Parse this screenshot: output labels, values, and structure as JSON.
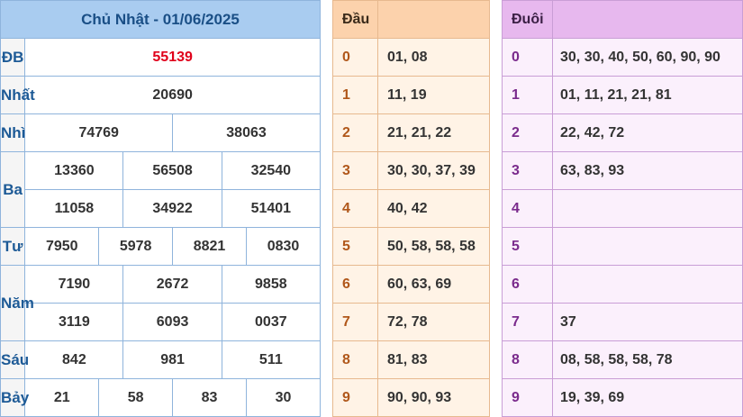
{
  "header": {
    "title": "Chủ Nhật - 01/06/2025"
  },
  "prizes": {
    "db": {
      "label": "ĐB",
      "values": [
        "55139"
      ]
    },
    "nhat": {
      "label": "Nhất",
      "values": [
        "20690"
      ]
    },
    "nhi": {
      "label": "Nhì",
      "values": [
        "74769",
        "38063"
      ]
    },
    "ba": {
      "label": "Ba",
      "values": [
        "13360",
        "56508",
        "32540",
        "11058",
        "34922",
        "51401"
      ]
    },
    "tu": {
      "label": "Tư",
      "values": [
        "7950",
        "5978",
        "8821",
        "0830"
      ]
    },
    "nam": {
      "label": "Năm",
      "values": [
        "7190",
        "2672",
        "9858",
        "3119",
        "6093",
        "0037"
      ]
    },
    "sau": {
      "label": "Sáu",
      "values": [
        "842",
        "981",
        "511"
      ]
    },
    "bay": {
      "label": "Bảy",
      "values": [
        "21",
        "58",
        "83",
        "30"
      ]
    }
  },
  "dau": {
    "header": "Đầu",
    "rows": [
      {
        "key": "0",
        "values": "01, 08"
      },
      {
        "key": "1",
        "values": "11, 19"
      },
      {
        "key": "2",
        "values": "21, 21, 22"
      },
      {
        "key": "3",
        "values": "30, 30, 37, 39"
      },
      {
        "key": "4",
        "values": "40, 42"
      },
      {
        "key": "5",
        "values": "50, 58, 58, 58"
      },
      {
        "key": "6",
        "values": "60, 63, 69"
      },
      {
        "key": "7",
        "values": "72, 78"
      },
      {
        "key": "8",
        "values": "81, 83"
      },
      {
        "key": "9",
        "values": "90, 90, 93"
      }
    ]
  },
  "duoi": {
    "header": "Đuôi",
    "rows": [
      {
        "key": "0",
        "values": "30, 30, 40, 50, 60, 90, 90"
      },
      {
        "key": "1",
        "values": "01, 11, 21, 21, 81"
      },
      {
        "key": "2",
        "values": "22, 42, 72"
      },
      {
        "key": "3",
        "values": "63, 83, 93"
      },
      {
        "key": "4",
        "values": ""
      },
      {
        "key": "5",
        "values": ""
      },
      {
        "key": "6",
        "values": ""
      },
      {
        "key": "7",
        "values": "37"
      },
      {
        "key": "8",
        "values": "08, 58, 58, 58, 78"
      },
      {
        "key": "9",
        "values": "19, 39, 69"
      }
    ]
  },
  "colors": {
    "header_blue": "#a9ccf0",
    "special_red": "#e0001a",
    "dau_orange": "#fcd2ac",
    "duoi_purple": "#e7b8ee"
  }
}
